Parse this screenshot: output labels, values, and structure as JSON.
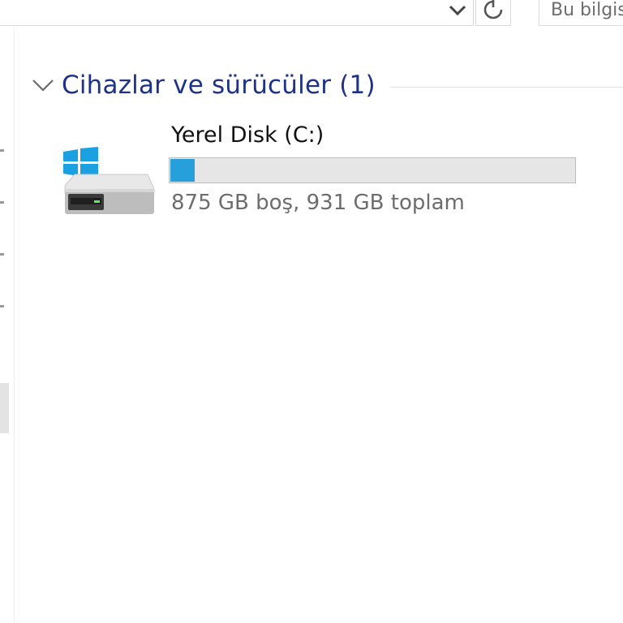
{
  "toolbar": {
    "address_dropdown_icon": "chevron-down-icon",
    "refresh_icon": "refresh-icon",
    "search_placeholder": "Bu bilgisayarda ara"
  },
  "nav_pane": {
    "tick_count": 4,
    "has_selected_item": true
  },
  "group": {
    "title": "Cihazlar ve sürücüler (1)",
    "collapse_icon": "chevron-down-icon"
  },
  "drives": [
    {
      "name": "Yerel Disk (C:)",
      "space_text": "875 GB boş, 931 GB toplam",
      "free_gb": 875,
      "total_gb": 931,
      "icon": "windows-drive-icon"
    }
  ],
  "colors": {
    "group_title": "#1e3287",
    "usage_fill": "#26a0da",
    "usage_track": "#e6e6e6",
    "windows_logo": "#1ba1e2"
  }
}
